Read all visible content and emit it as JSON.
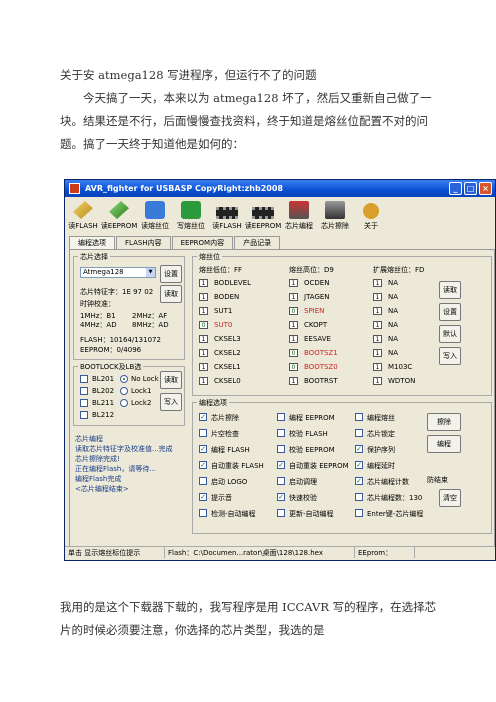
{
  "doc": {
    "title": "关于安 atmega128 写进程序，但运行不了的问题",
    "para1": "今天搞了一天，本来以为 atmega128 坏了，然后又重新自己做了一块。结果还是不行，后面慢慢查找资料，终于知道是熔丝位配置不对的问题。搞了一天终于知道他是如何的：",
    "para2": "我用的是这个下载器下载的，我写程序是用 ICCAVR 写的程序，在选择芯片的时候必须要注意，你选择的芯片类型，我选的是"
  },
  "window": {
    "title": "AVR_fighter for USBASP CopyRight:zhb2008",
    "buttons": [
      "_",
      "□",
      "×"
    ]
  },
  "toolbar": [
    {
      "label": "读FLASH",
      "icon": "read-flash-icon"
    },
    {
      "label": "读EEPROM",
      "icon": "read-eeprom-icon"
    },
    {
      "label": "读熔丝位",
      "icon": "read-fuse-icon"
    },
    {
      "label": "写熔丝位",
      "icon": "write-fuse-icon"
    },
    {
      "label": "读FLASH",
      "icon": "chip-icon"
    },
    {
      "label": "读EEPROM",
      "icon": "chip-icon"
    },
    {
      "label": "芯片编程",
      "icon": "program-chip-icon"
    },
    {
      "label": "芯片擦除",
      "icon": "erase-chip-icon"
    },
    {
      "label": "关于",
      "icon": "about-icon"
    }
  ],
  "tabs": [
    "编程选项",
    "FLASH内容",
    "EEPROM内容",
    "产品记录"
  ],
  "chip": {
    "group": "芯片选择",
    "selected": "Atmega128",
    "set": "设置",
    "read": "读取",
    "sig_label": "芯片特征字：",
    "sig": "1E 97 02",
    "clock_label": "时钟校准：",
    "clocks": [
      "1MHz：B1",
      "2MHz：AF",
      "4MHz：AD",
      "8MHz：AD"
    ],
    "flash": "FLASH：10164/131072",
    "eeprom": "EEPROM：0/4096"
  },
  "lock": {
    "group": "BOOTLOCK及LB选",
    "items": [
      "BL201",
      "BL202",
      "BL211",
      "BL212"
    ],
    "radios": [
      "No Lock",
      "Lock1",
      "Lock2"
    ],
    "read": "读取",
    "write": "写入"
  },
  "log": [
    "芯片编程",
    "读取芯片特征字及校准值...完成",
    "芯片擦除完成!",
    "正在编程Flash，请等待...",
    "编程Flash完成",
    "<芯片编程结束>"
  ],
  "fuse": {
    "group": "熔丝位",
    "low": "熔丝低位：FF",
    "high": "熔丝高位：D9",
    "ext": "扩展熔丝位：FD",
    "col1": [
      [
        "BODLEVEL",
        "1",
        false
      ],
      [
        "BODEN",
        "1",
        false
      ],
      [
        "SUT1",
        "1",
        false
      ],
      [
        "SUT0",
        "0",
        true
      ],
      [
        "CKSEL3",
        "1",
        false
      ],
      [
        "CKSEL2",
        "1",
        false
      ],
      [
        "CKSEL1",
        "1",
        false
      ],
      [
        "CKSEL0",
        "1",
        false
      ]
    ],
    "col2": [
      [
        "OCDEN",
        "1",
        false
      ],
      [
        "JTAGEN",
        "1",
        false
      ],
      [
        "SPIEN",
        "0",
        true
      ],
      [
        "CKOPT",
        "1",
        false
      ],
      [
        "EESAVE",
        "1",
        false
      ],
      [
        "BOOTSZ1",
        "0",
        true
      ],
      [
        "BOOTSZ0",
        "0",
        true
      ],
      [
        "BOOTRST",
        "1",
        false
      ]
    ],
    "col3": [
      [
        "NA",
        "1"
      ],
      [
        "NA",
        "1"
      ],
      [
        "NA",
        "1"
      ],
      [
        "NA",
        "1"
      ],
      [
        "NA",
        "1"
      ],
      [
        "NA",
        "1"
      ],
      [
        "M103C",
        "1"
      ],
      [
        "WDTON",
        "1"
      ]
    ],
    "btns": [
      "读取",
      "设置",
      "默认",
      "写入"
    ]
  },
  "prog": {
    "group": "编程选项",
    "rows": [
      [
        "芯片擦除",
        "编程 EEPROM",
        "编程熔丝"
      ],
      [
        "片空检查",
        "校验 FLASH",
        "芯片锁定"
      ],
      [
        "编程 FLASH",
        "校验 EEPROM",
        "保护序列"
      ],
      [
        "自动重装 FLASH",
        "自动重装 EEPROM",
        "编程延时"
      ],
      [
        "启动 LOGO",
        "启动调理",
        "芯片编程计数"
      ],
      [
        "提示音",
        "快速校验",
        "芯片编程数：130"
      ],
      [
        "检测-自动编程",
        "更新-自动编程",
        "Enter键-芯片编程"
      ]
    ],
    "checked": [
      [
        true,
        false,
        false
      ],
      [
        false,
        false,
        false
      ],
      [
        true,
        false,
        true
      ],
      [
        true,
        true,
        true
      ],
      [
        false,
        false,
        true
      ],
      [
        true,
        true,
        false
      ],
      [
        false,
        false,
        false
      ]
    ],
    "extra": "防结束",
    "btn_erase": "擦除",
    "btn_program": "编程",
    "btn_clear": "清空"
  },
  "status": [
    "单击 显示熔丝标位提示",
    "Flash：C:\\Documen...rator\\桌面\\128\\128.hex",
    "EEprom："
  ]
}
